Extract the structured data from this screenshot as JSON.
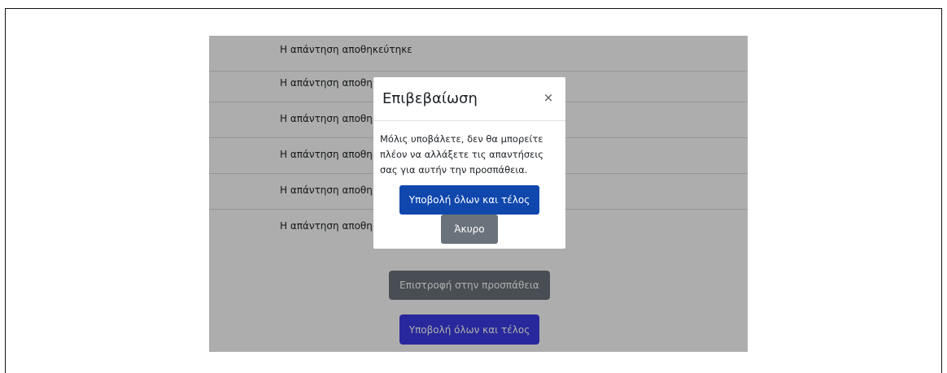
{
  "rows": [
    {
      "text": "Η απάντηση αποθηκεύτηκε"
    },
    {
      "text": "Η απάντηση αποθηκ"
    },
    {
      "text": "Η απάντηση αποθηκ"
    },
    {
      "text": "Η απάντηση αποθηκ"
    },
    {
      "text": "Η απάντηση αποθηκ"
    },
    {
      "text": "Η απάντηση αποθηκ"
    }
  ],
  "actions": {
    "return_label": "Επιστροφή στην προσπάθεια",
    "submit_label": "Υποβολή όλων και τέλος"
  },
  "modal": {
    "title": "Επιβεβαίωση",
    "close_symbol": "×",
    "body": "Μόλις υποβάλετε, δεν θα μπορείτε πλέον να αλλάξετε τις απαντήσεις σας για αυτήν την προσπάθεια.",
    "submit_label": "Υποβολή όλων και τέλος",
    "cancel_label": "Άκυρο"
  },
  "colors": {
    "submit_primary": "#0f47ad",
    "submit_behind": "#3c3ce6",
    "secondary": "#6a737b"
  }
}
